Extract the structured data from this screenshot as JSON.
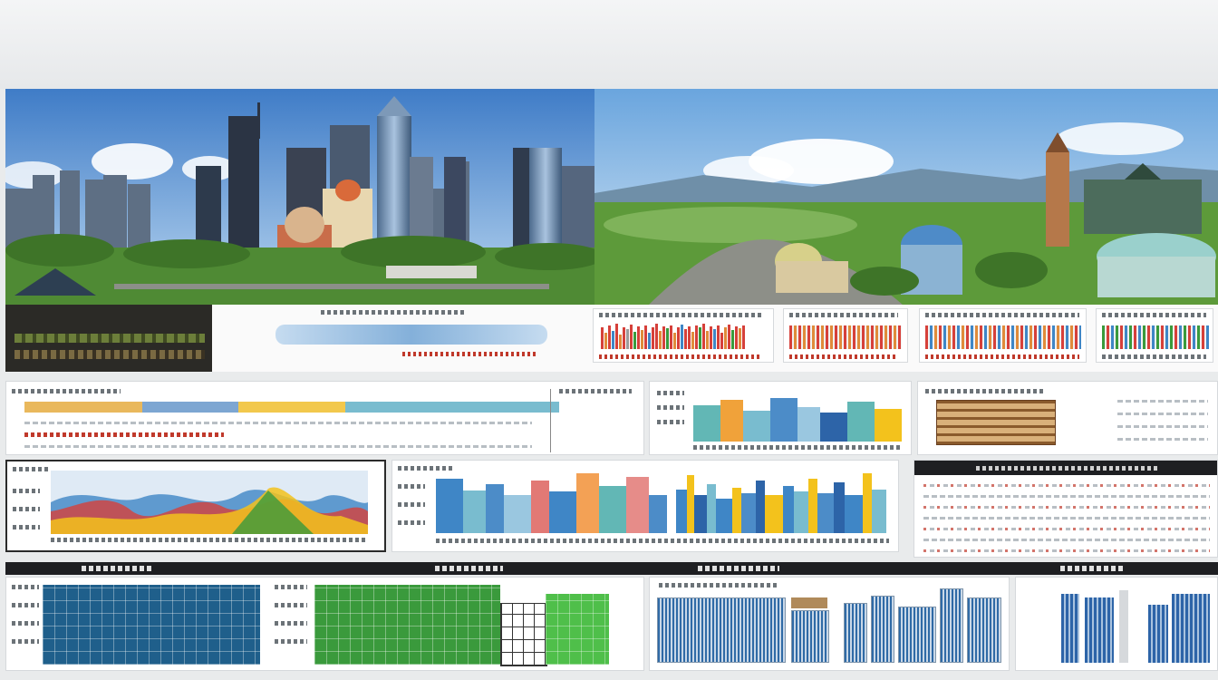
{
  "palette": {
    "sky_left": "#5a8fd0",
    "sky_right": "#7fb4e6",
    "park_green": "#4f8a34",
    "chart_blue": "#3f86c6",
    "chart_orange": "#f08a2a",
    "chart_yellow": "#f3c21c",
    "chart_red": "#d6403a",
    "building_navy": "#1f5f8b",
    "building_green": "#3a9a3c"
  },
  "icons": {
    "skyline": "city-skyline-icon",
    "dome": "dome-building-icon",
    "tower": "clock-tower-icon",
    "mountain": "mountain-range-icon"
  },
  "sections": [
    {
      "id": "hero-left",
      "kind": "city-skyline-photo"
    },
    {
      "id": "hero-right",
      "kind": "valley-landmarks-photo"
    },
    {
      "id": "mid-row",
      "kind": "chart-panels"
    },
    {
      "id": "bottom-row",
      "kind": "building-panels"
    }
  ]
}
